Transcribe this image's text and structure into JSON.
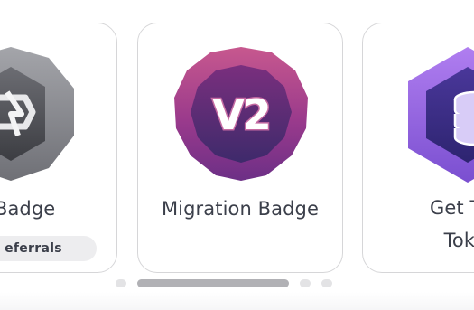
{
  "carousel": {
    "cards": [
      {
        "title": "y Badge",
        "chip": "eferrals",
        "icon": "referral-badge-icon",
        "colors": {
          "outer": "#8d8e94",
          "inner": "#55565c"
        }
      },
      {
        "title": "Migration Badge",
        "icon": "v2-migration-badge-icon",
        "badge_text": "V2",
        "colors": {
          "outer": "#9d3b8a",
          "inner": "#5b2a78"
        }
      },
      {
        "title": "Get Tes\nToke",
        "icon": "test-token-badge-icon",
        "colors": {
          "outer": "#9b63e0",
          "inner": "#3c2a8c"
        }
      }
    ],
    "page_indicator": {
      "count": 4,
      "active_index": 1
    }
  }
}
